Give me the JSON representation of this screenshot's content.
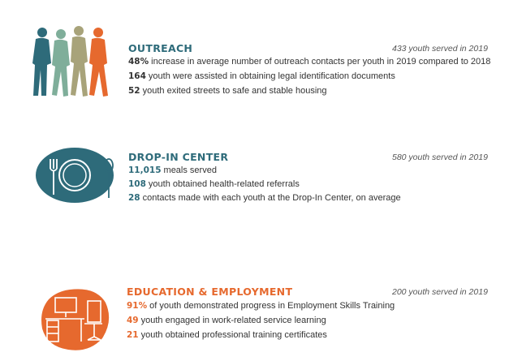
{
  "sections": {
    "outreach": {
      "title": "OUTREACH",
      "served": "433 youth served in 2019",
      "stats": [
        {
          "num": "48%",
          "text": "increase in average number of outreach contacts per youth in 2019 compared to 2018"
        },
        {
          "num": "164",
          "text": "youth were assisted in obtaining legal identification documents"
        },
        {
          "num": "52",
          "text": "youth exited streets to safe and stable housing"
        }
      ]
    },
    "dropin": {
      "title": "DROP-IN CENTER",
      "served": "580 youth served in 2019",
      "stats": [
        {
          "num": "11,015",
          "text": "meals served"
        },
        {
          "num": "108",
          "text": "youth obtained health-related referrals"
        },
        {
          "num": "28",
          "text": "contacts made with each youth at the Drop-In Center, on average"
        }
      ]
    },
    "education": {
      "title": "EDUCATION & EMPLOYMENT",
      "served": "200 youth served in 2019",
      "stats": [
        {
          "num": "91%",
          "text": "of youth demonstrated progress in Employment Skills Training"
        },
        {
          "num": "49",
          "text": "youth engaged in work-related service learning"
        },
        {
          "num": "21",
          "text": "youth obtained professional training certificates"
        }
      ]
    }
  },
  "colors": {
    "teal": "#2e6b7a",
    "orange": "#e6692e",
    "sage": "#7fae9a",
    "khaki": "#a8a37a",
    "text": "#333333"
  },
  "icons": {
    "outreach": "walking-people-icon",
    "dropin": "plate-fork-spoon-icon",
    "education": "desk-chair-icon"
  }
}
